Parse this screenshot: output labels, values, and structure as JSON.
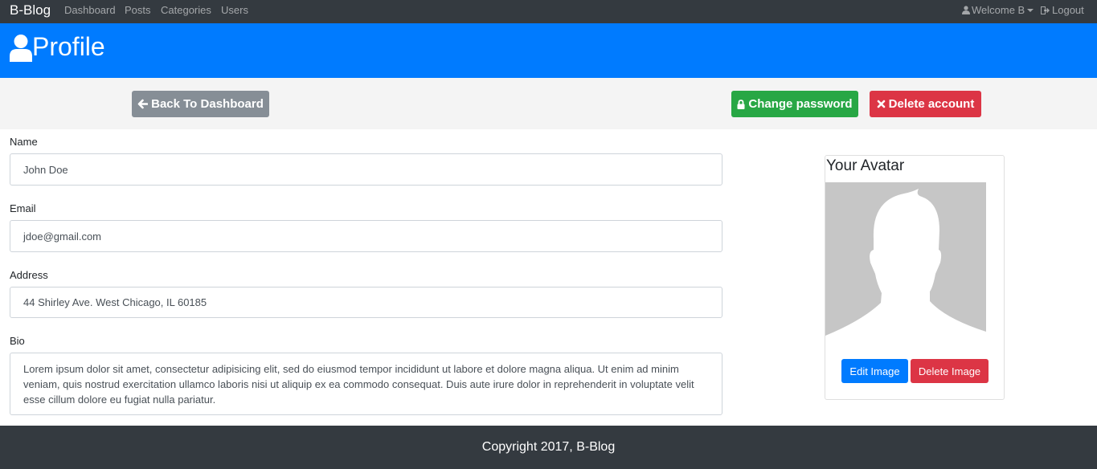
{
  "navbar": {
    "brand": "B-Blog",
    "links": [
      "Dashboard",
      "Posts",
      "Categories",
      "Users"
    ],
    "welcome": "Welcome B",
    "logout": "Logout"
  },
  "header": {
    "title": "Profile",
    "icon": "user-icon"
  },
  "actions": {
    "back_label": "Back To Dashboard",
    "change_password_label": "Change password",
    "delete_account_label": "Delete account"
  },
  "form": {
    "name_label": "Name",
    "name_value": "John Doe",
    "email_label": "Email",
    "email_value": "jdoe@gmail.com",
    "address_label": "Address",
    "address_value": "44 Shirley Ave. West Chicago, IL 60185",
    "bio_label": "Bio",
    "bio_value": "Lorem ipsum dolor sit amet, consectetur adipisicing elit, sed do eiusmod tempor incididunt ut labore et dolore magna aliqua. Ut enim ad minim veniam, quis nostrud exercitation ullamco laboris nisi ut aliquip ex ea commodo consequat. Duis aute irure dolor in reprehenderit in voluptate velit esse cillum dolore eu fugiat nulla pariatur."
  },
  "avatar_card": {
    "title": "Your Avatar",
    "edit_label": "Edit Image",
    "delete_label": "Delete Image"
  },
  "footer": {
    "text": "Copyright 2017, B-Blog"
  },
  "colors": {
    "navbar": "#343a40",
    "primary": "#007bff",
    "success": "#28a745",
    "danger": "#dc3545",
    "secondary": "#868e96"
  }
}
